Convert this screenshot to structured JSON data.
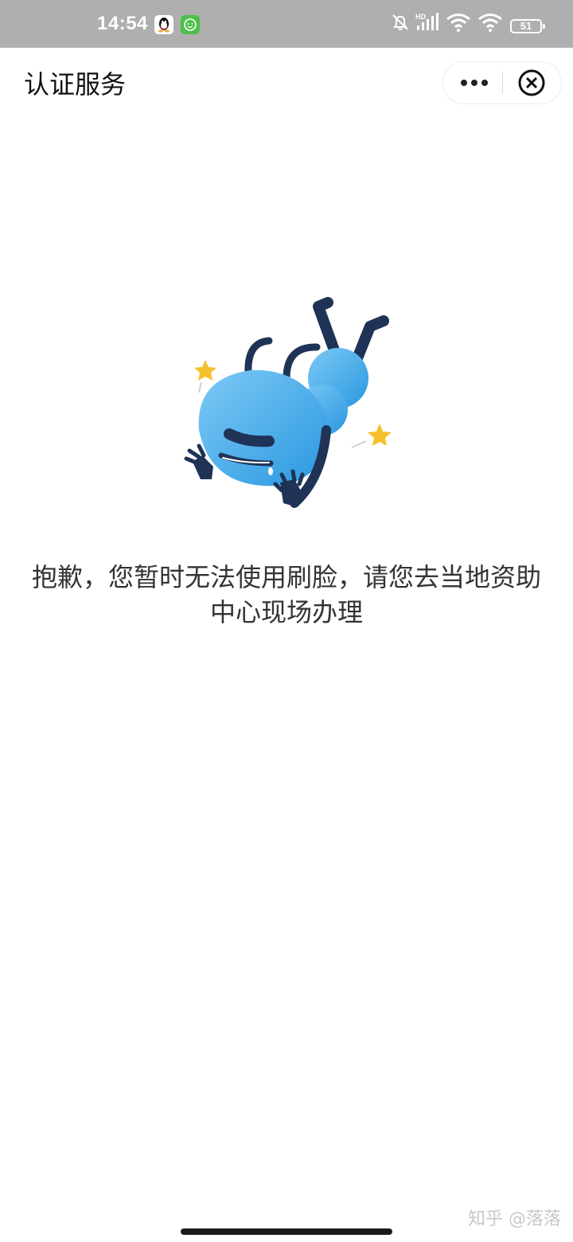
{
  "status_bar": {
    "time": "14:54",
    "battery": "51",
    "network": "HD",
    "icons": [
      "qq-icon",
      "green-app-icon",
      "bell-off-icon",
      "signal-icon",
      "wifi-icon",
      "wifi-icon",
      "battery-icon"
    ]
  },
  "nav": {
    "title": "认证服务",
    "more_icon": "more-dots-icon",
    "close_icon": "close-circle-icon"
  },
  "content": {
    "illustration": "ant-mascot-fallen",
    "message": "抱歉，您暂时无法使用刷脸，请您去当地资助中心现场办理"
  },
  "watermark": "知乎 @落落",
  "colors": {
    "status_bar_bg": "#afafaf",
    "mascot_blue": "#3aa3e6",
    "mascot_dark": "#1f3357",
    "star": "#f5c02a",
    "text": "#333333"
  }
}
